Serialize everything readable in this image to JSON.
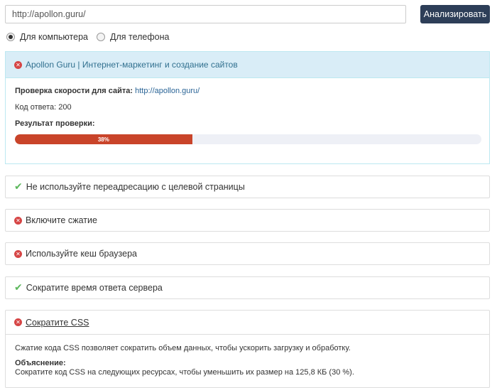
{
  "search": {
    "url_value": "http://apollon.guru/",
    "analyze_label": "Анализировать"
  },
  "device": {
    "options": [
      {
        "label": "Для компьютера",
        "selected": true
      },
      {
        "label": "Для телефона",
        "selected": false
      }
    ]
  },
  "result": {
    "site_title": "Apollon Guru | Интернет-маркетинг и создание сайтов",
    "speed_check_label": "Проверка скорости для сайта:",
    "speed_check_url": "http://apollon.guru/",
    "response_code_label": "Код ответа:",
    "response_code_value": "200",
    "check_result_label": "Результат проверки:",
    "score_percent": 38,
    "score_label": "38%",
    "score_color": "#c9442a"
  },
  "recommendations": [
    {
      "text": "Не используйте переадресацию с целевой страницы",
      "status": "pass",
      "icon": "check-icon"
    },
    {
      "text": "Включите сжатие",
      "status": "fail",
      "icon": "error-circle-icon"
    },
    {
      "text": "Используйте кеш браузера",
      "status": "fail",
      "icon": "error-circle-icon"
    },
    {
      "text": "Сократите время ответа сервера",
      "status": "pass",
      "icon": "check-icon"
    }
  ],
  "css_section": {
    "title": "Сократите CSS",
    "status": "fail",
    "icon": "error-circle-icon",
    "description": "Сжатие кода CSS позволяет сократить объем данных, чтобы ускорить загрузку и обработку.",
    "explanation_title": "Объяснение:",
    "explanation_text": "Сократите код CSS на следующих ресурсах, чтобы уменьшить их размер на 125,8 КБ (30 %)."
  },
  "colors": {
    "button_bg": "#2d3e58",
    "info_bg": "#d9edf7",
    "error_red": "#d64545",
    "pass_green": "#5cb85c"
  }
}
